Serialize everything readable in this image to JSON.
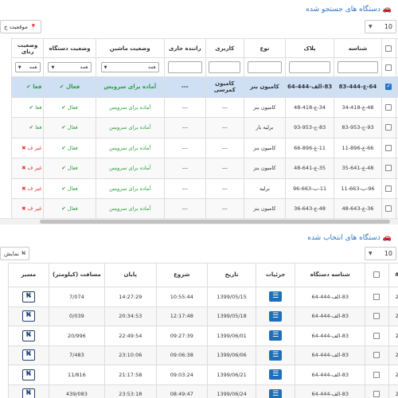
{
  "search_panel": {
    "title": "دستگاه های جستجو شده",
    "page_size": "10",
    "location_button": "موقعیت ج",
    "headers": [
      "#",
      "",
      "شناسه",
      "پلاک",
      "نوع",
      "کاربری",
      "راننده جاری",
      "وضعیت ماشین",
      "وضعیت دستگاه",
      "وضعیت رنای"
    ],
    "filter_all": "همه",
    "rows": [
      {
        "num": "1",
        "checked": true,
        "id": "64-ع-444-83",
        "plate": "83-الف-444-64",
        "type": "کامیون بنز",
        "usage": "کامیون کمرسی",
        "driver": "---",
        "machine": "آماده برای سرویس",
        "device": "فعال",
        "last": "فعا",
        "last_ok": true
      },
      {
        "num": "2",
        "checked": false,
        "id": "48-ع-418-34",
        "plate": "34-ع-418-48",
        "type": "کامیون بنز",
        "usage": "---",
        "driver": "---",
        "machine": "آماده برای سرویس",
        "device": "فعال",
        "last": "فعا",
        "last_ok": true
      },
      {
        "num": "2",
        "checked": false,
        "id": "93-ج-953-83",
        "plate": "83-ج-953-93",
        "type": "برلیه بار",
        "usage": "---",
        "driver": "---",
        "machine": "آماده برای سرویس",
        "device": "فعال",
        "last": "فعا",
        "last_ok": true
      },
      {
        "num": "2",
        "checked": false,
        "id": "66-ع-896-11",
        "plate": "11-ع-896-66",
        "type": "کامیون بنز",
        "usage": "---",
        "driver": "---",
        "machine": "آماده برای سرویس",
        "device": "فعال",
        "last": "غیر ف",
        "last_ok": false
      },
      {
        "num": "2",
        "checked": false,
        "id": "48-ع-641-35",
        "plate": "35-ع-641-48",
        "type": "کامیون بنز",
        "usage": "---",
        "driver": "---",
        "machine": "آماده برای سرویس",
        "device": "فعال",
        "last": "غیر ف",
        "last_ok": false
      },
      {
        "num": "2",
        "checked": false,
        "id": "96-ب-663-11",
        "plate": "11-ب-663-96",
        "type": "برلیه",
        "usage": "---",
        "driver": "---",
        "machine": "آماده برای سرویس",
        "device": "فعال",
        "last": "غیر ف",
        "last_ok": false
      },
      {
        "num": "2",
        "checked": false,
        "id": "36-ع-643-48",
        "plate": "48-ع-643-36",
        "type": "کامیون بنز",
        "usage": "---",
        "driver": "---",
        "machine": "آماده برای سرویس",
        "device": "فعال",
        "last": "غیر ف",
        "last_ok": false
      }
    ]
  },
  "selected_panel": {
    "title": "دستگاه های انتخاب شده",
    "page_size": "10",
    "show_button": "نمایش",
    "headers": [
      "#",
      "",
      "شناسه دستگاه",
      "جزئیات",
      "تاریخ",
      "شروع",
      "پایان",
      "مسافت (کیلومتر)",
      "مسیر"
    ],
    "rows": [
      {
        "num": "2",
        "id": "83-الف-444-64",
        "date": "1399/05/15",
        "start": "10:55:44",
        "end": "14:27:29",
        "distance": "7/074"
      },
      {
        "num": "2",
        "id": "83-الف-444-64",
        "date": "1399/05/18",
        "start": "12:17:48",
        "end": "20:34:53",
        "distance": "0/039"
      },
      {
        "num": "2",
        "id": "83-الف-444-64",
        "date": "1399/06/01",
        "start": "09:27:39",
        "end": "22:49:54",
        "distance": "20/996"
      },
      {
        "num": "2",
        "id": "83-الف-444-64",
        "date": "1399/06/06",
        "start": "09:06:38",
        "end": "23:10:06",
        "distance": "7/483"
      },
      {
        "num": "2",
        "id": "83-الف-444-64",
        "date": "1399/06/21",
        "start": "09:03:24",
        "end": "21:17:58",
        "distance": "11/816"
      },
      {
        "num": "2",
        "id": "83-الف-444-64",
        "date": "1399/06/24",
        "start": "08:49:47",
        "end": "23:53:18",
        "distance": "439/083"
      }
    ]
  }
}
